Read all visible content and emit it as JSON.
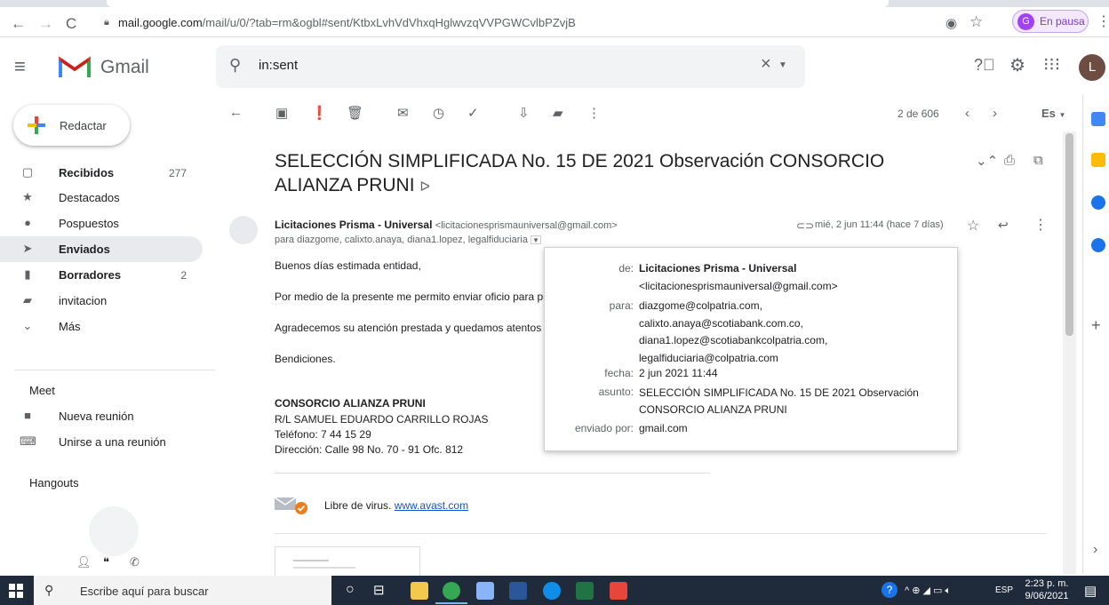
{
  "browser": {
    "url_host": "mail.google.com",
    "url_path": "/mail/u/0/?tab=rm&ogbl#sent/KtbxLvhVdVhxqHglwvzqVVPGWCvlbPZvjB",
    "profile_initial": "G",
    "profile_label": "En pausa"
  },
  "gmail": {
    "brand": "Gmail",
    "search_value": "in:sent",
    "account_initial": "L"
  },
  "sidebar": {
    "compose_label": "Redactar",
    "items": [
      {
        "label": "Recibidos",
        "count": "277",
        "icon": "inbox-icon"
      },
      {
        "label": "Destacados",
        "count": "",
        "icon": "star-icon"
      },
      {
        "label": "Pospuestos",
        "count": "",
        "icon": "clock-icon"
      },
      {
        "label": "Enviados",
        "count": "",
        "icon": "send-icon"
      },
      {
        "label": "Borradores",
        "count": "2",
        "icon": "draft-icon"
      },
      {
        "label": "invitacion",
        "count": "",
        "icon": "label-icon"
      },
      {
        "label": "Más",
        "count": "",
        "icon": "chevron-down-icon"
      }
    ],
    "meet_title": "Meet",
    "meet_items": [
      {
        "label": "Nueva reunión",
        "icon": "video-icon"
      },
      {
        "label": "Unirse a una reunión",
        "icon": "keyboard-icon"
      }
    ],
    "hangouts_title": "Hangouts"
  },
  "toolbar": {
    "pager": "2 de 606",
    "language": "Es"
  },
  "message": {
    "subject": "SELECCIÓN SIMPLIFICADA No. 15 DE 2021 Observación CONSORCIO ALIANZA PRUNI",
    "sender_name": "Licitaciones Prisma - Universal",
    "sender_email": "<licitacionesprismauniversal@gmail.com>",
    "recipients": "para diazgome, calixto.anaya, diana1.lopez, legalfiduciaria",
    "date": "mié, 2 jun 11:44 (hace 7 días)",
    "body": [
      "Buenos días estimada entidad,",
      "Por medio de la presente me permito enviar oficio para pr",
      "Agradecemos su atención prestada y quedamos atentos",
      "Bendiciones."
    ],
    "signature": {
      "company": "CONSORCIO ALIANZA PRUNI",
      "rep": "R/L SAMUEL EDUARDO CARRILLO ROJAS",
      "phone": "Teléfono: 7 44 15 29",
      "address": "Dirección: Calle 98 No. 70 - 91 Ofc. 812"
    },
    "virus_text": "Libre de virus.",
    "virus_link": "www.avast.com"
  },
  "details": {
    "from_label": "de:",
    "from_name": "Licitaciones Prisma - Universal",
    "from_email": "<licitacionesprismauniversal@gmail.com>",
    "to_label": "para:",
    "to_list": "diazgome@colpatria.com,\ncalixto.anaya@scotiabank.com.co,\ndiana1.lopez@scotiabankcolpatria.com,\nlegalfiduciaria@colpatria.com",
    "date_label": "fecha:",
    "date_value": "2 jun 2021 11:44",
    "subject_label": "asunto:",
    "subject_value": "SELECCIÓN SIMPLIFICADA No. 15 DE 2021 Observación CONSORCIO ALIANZA PRUNI",
    "sent_by_label": "enviado por:",
    "sent_by_value": "gmail.com"
  },
  "taskbar": {
    "search_placeholder": "Escribe aquí para buscar",
    "lang": "ESP",
    "time": "2:23 p. m.",
    "date": "9/06/2021"
  },
  "colors": {
    "accent": "#1a73e8",
    "active_nav": "#e8eaed",
    "taskbar": "#1f2b3a"
  }
}
